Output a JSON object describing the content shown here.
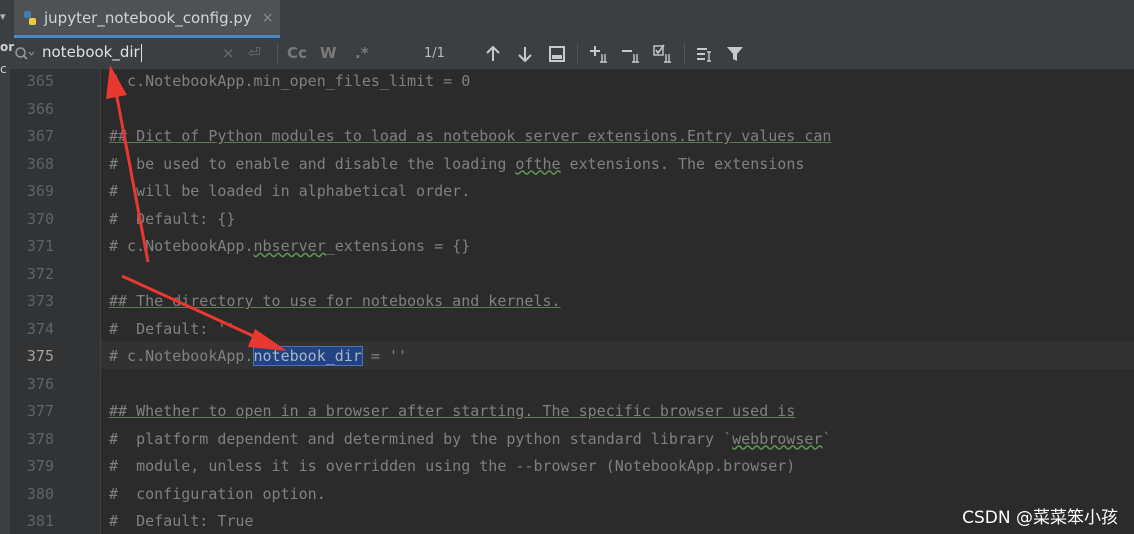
{
  "tab": {
    "filename": "jupyter_notebook_config.py",
    "close": "×"
  },
  "left_edge": {
    "caret": "▾",
    "frag1": "or",
    "frag2": "c"
  },
  "search": {
    "query": "notebook_dir",
    "clear": "×",
    "newline": "⏎",
    "options": {
      "match_case": "Cc",
      "words": "W",
      "regex": ".*"
    },
    "match_count": "1/1"
  },
  "editor": {
    "current_line": "375",
    "lines": [
      {
        "num": "365",
        "segs": [
          {
            "t": "# c.NotebookApp.min_open_files_limit = 0"
          }
        ]
      },
      {
        "num": "366",
        "segs": [
          {
            "t": ""
          }
        ]
      },
      {
        "num": "367",
        "segs": [
          {
            "t": "## Dict of Python modules to load as notebook server extensions.Entry values can",
            "c": "doc"
          }
        ]
      },
      {
        "num": "368",
        "segs": [
          {
            "t": "#  be used to enable and disable the loading "
          },
          {
            "t": "ofthe",
            "c": "wavy"
          },
          {
            "t": " extensions. The extensions"
          }
        ]
      },
      {
        "num": "369",
        "segs": [
          {
            "t": "#  will be loaded in alphabetical order."
          }
        ]
      },
      {
        "num": "370",
        "segs": [
          {
            "t": "#  Default: {}"
          }
        ]
      },
      {
        "num": "371",
        "segs": [
          {
            "t": "# c.NotebookApp."
          },
          {
            "t": "nbserver",
            "c": "wavy"
          },
          {
            "t": "_extensions = {}"
          }
        ]
      },
      {
        "num": "372",
        "segs": [
          {
            "t": ""
          }
        ]
      },
      {
        "num": "373",
        "segs": [
          {
            "t": "## The directory to use for notebooks and kernels.",
            "c": "doc"
          }
        ]
      },
      {
        "num": "374",
        "segs": [
          {
            "t": "#  Default: ''"
          }
        ]
      },
      {
        "num": "375",
        "segs": [
          {
            "t": "# c.NotebookApp."
          },
          {
            "t": "notebook_dir",
            "c": "hl"
          },
          {
            "t": " = ''"
          }
        ]
      },
      {
        "num": "376",
        "segs": [
          {
            "t": ""
          }
        ]
      },
      {
        "num": "377",
        "segs": [
          {
            "t": "## Whether to open in a browser after starting. The specific browser used is",
            "c": "doc"
          }
        ]
      },
      {
        "num": "378",
        "segs": [
          {
            "t": "#  platform dependent and determined by the python standard library `"
          },
          {
            "t": "webbrowser",
            "c": "wavy"
          },
          {
            "t": "`"
          }
        ]
      },
      {
        "num": "379",
        "segs": [
          {
            "t": "#  module, unless it is overridden using the --browser (NotebookApp.browser)"
          }
        ]
      },
      {
        "num": "380",
        "segs": [
          {
            "t": "#  configuration option."
          }
        ]
      },
      {
        "num": "381",
        "segs": [
          {
            "t": "#  Default: True"
          }
        ]
      }
    ]
  },
  "watermark": "CSDN @菜菜笨小孩",
  "colors": {
    "background": "#2b2b2b",
    "comment": "#808080",
    "selection": "#214283",
    "arrow": "#e8382f",
    "tab_underline": "#4a88c7"
  }
}
